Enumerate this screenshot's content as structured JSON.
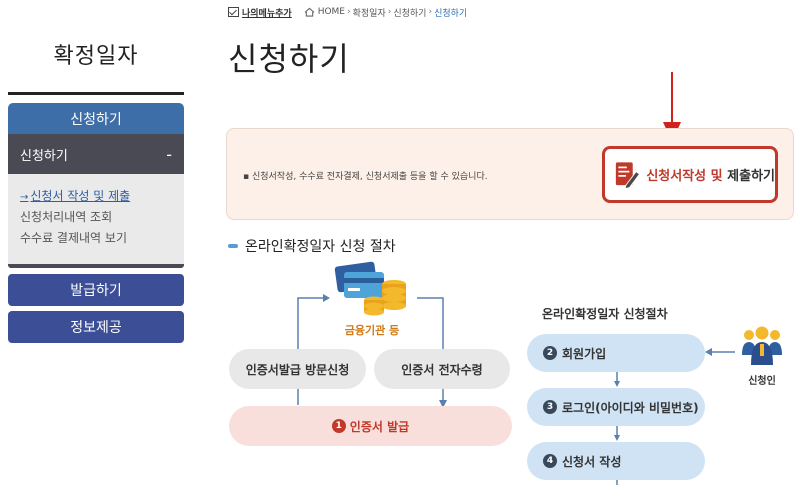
{
  "topbar": {
    "my_menu_label": "나의메뉴추가",
    "breadcrumb": [
      "HOME",
      "확정일자",
      "신청하기",
      "신청하기"
    ]
  },
  "sidebar": {
    "title": "확정일자",
    "apply_label": "신청하기",
    "sub_label": "신청하기",
    "sub_toggle": "-",
    "items": [
      {
        "label": "신청서 작성 및 제출",
        "active": true
      },
      {
        "label": "신청처리내역 조회",
        "active": false
      },
      {
        "label": "수수료 결제내역 보기",
        "active": false
      }
    ],
    "issue_label": "발급하기",
    "info_label": "정보제공"
  },
  "main": {
    "title": "신청하기",
    "info_text": "신청서작성, 수수료 전자결제, 신청서제출 등을 할 수 있습니다.",
    "apply_button": {
      "red_text": "신청서작성 및",
      "dark_text": "제출하기"
    },
    "section_title": "온라인확정일자 신청 절차"
  },
  "diagram": {
    "bank_label": "금융기관 등",
    "cert_visit": "인증서발급 방문신청",
    "cert_receive": "인증서 전자수령",
    "cert_issue_num": "1",
    "cert_issue": "인증서 발급",
    "flow_title": "온라인확정일자 신청절차",
    "steps": [
      {
        "num": "2",
        "label": "회원가입"
      },
      {
        "num": "3",
        "label": "로그인(아이디와 비밀번호)"
      },
      {
        "num": "4",
        "label": "신청서 작성"
      }
    ],
    "applicant_label": "신청인"
  },
  "colors": {
    "nav_blue": "#3e6ea8",
    "nav_dark": "#4a4a55",
    "nav_indigo": "#3b4e96",
    "accent_red": "#c0392b",
    "flow_blue": "#cfe3f4"
  }
}
